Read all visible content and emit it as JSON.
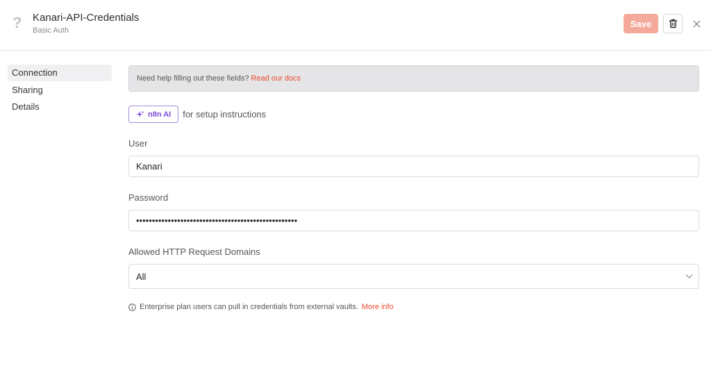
{
  "header": {
    "title": "Kanari-API-Credentials",
    "subtitle": "Basic Auth",
    "icon": "question-icon",
    "save_label": "Save",
    "delete_icon": "trash-icon",
    "close_icon": "close-icon"
  },
  "sidebar": {
    "items": [
      {
        "label": "Connection",
        "active": true
      },
      {
        "label": "Sharing",
        "active": false
      },
      {
        "label": "Details",
        "active": false
      }
    ]
  },
  "main": {
    "help_text": "Need help filling out these fields?",
    "help_link": "Read our docs",
    "ai_button_label": "n8n AI",
    "ai_button_icon": "sparkle-icon",
    "ai_suffix": "for setup instructions",
    "user_label": "User",
    "user_value": "Kanari",
    "password_label": "Password",
    "password_value": "•••••••••••••••••••••••••••••••••••••••••••••••••••",
    "domains_label": "Allowed HTTP Request Domains",
    "domains_value": "All",
    "note_icon": "info-icon",
    "note_text": "Enterprise plan users can pull in credentials from external vaults.",
    "note_link": "More info"
  },
  "colors": {
    "accent": "#ea4b2a",
    "save_disabled": "#f5a99a",
    "ai_purple": "#7a4dd6"
  }
}
